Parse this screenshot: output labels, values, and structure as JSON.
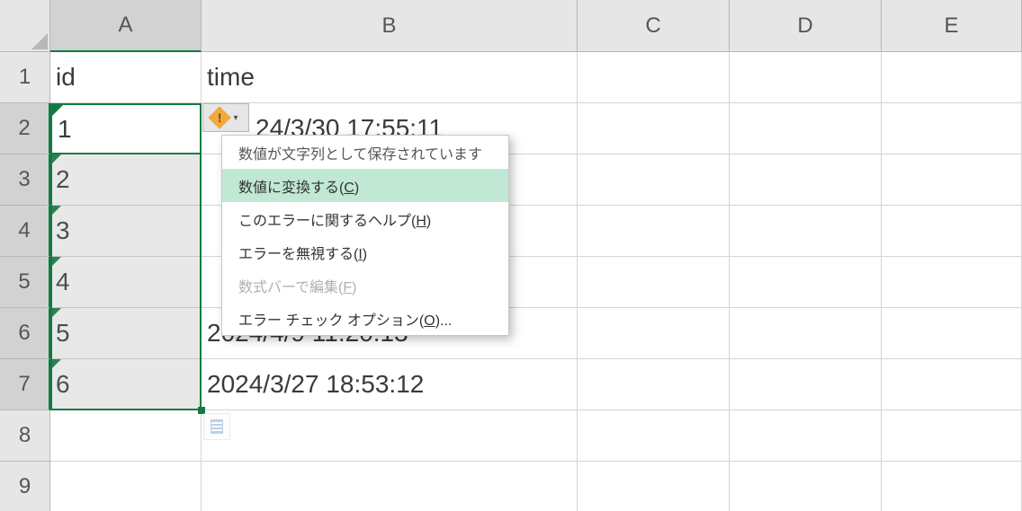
{
  "columns": [
    "A",
    "B",
    "C",
    "D",
    "E"
  ],
  "rows": [
    1,
    2,
    3,
    4,
    5,
    6,
    7,
    8,
    9
  ],
  "selected_column": "A",
  "selected_rows": [
    2,
    3,
    4,
    5,
    6,
    7
  ],
  "active_cell": {
    "col": "A",
    "row": 2,
    "value": "1"
  },
  "cells": {
    "A1": "id",
    "B1": "time",
    "A2": "1",
    "B2": "24/3/30  17:55:11",
    "A3": "2",
    "A4": "3",
    "A5": "4",
    "A6": "5",
    "B6": "2024/4/9  11:20:13",
    "A7": "6",
    "B7": "2024/3/27  18:53:12"
  },
  "error_icon": {
    "semantic": "number-stored-as-text-icon",
    "exclaim": "!"
  },
  "menu": {
    "header": "数値が文字列として保存されています",
    "items": [
      {
        "label_pre": "数値に変換する(",
        "key": "C",
        "label_post": ")",
        "state": "hover"
      },
      {
        "label_pre": "このエラーに関するヘルプ(",
        "key": "H",
        "label_post": ")",
        "state": "normal"
      },
      {
        "label_pre": "エラーを無視する(",
        "key": "I",
        "label_post": ")",
        "state": "normal"
      },
      {
        "label_pre": "数式バーで編集(",
        "key": "F",
        "label_post": ")",
        "state": "disabled"
      },
      {
        "label_pre": "エラー チェック オプション(",
        "key": "O",
        "label_post": ")...",
        "state": "normal"
      }
    ]
  }
}
